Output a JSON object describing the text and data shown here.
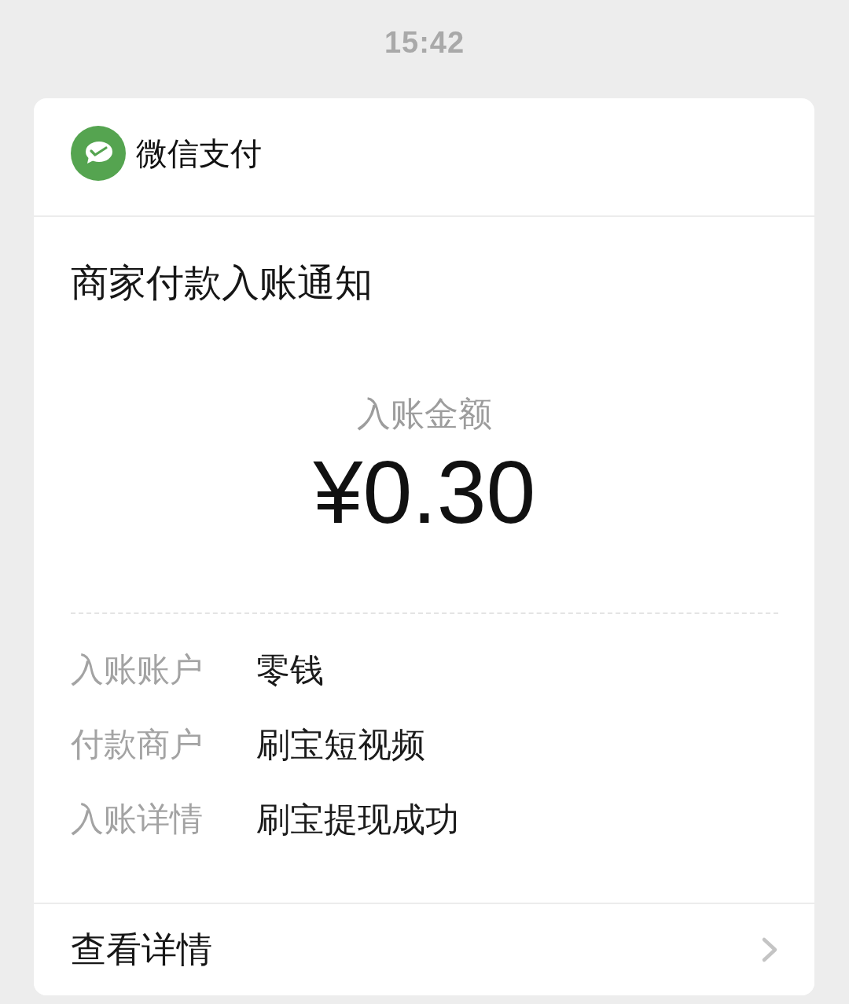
{
  "timestamp": "15:42",
  "card": {
    "brand": {
      "name": "微信支付"
    },
    "title": "商家付款入账通知",
    "amount": {
      "label": "入账金额",
      "value": "¥0.30"
    },
    "details": [
      {
        "label": "入账账户",
        "value": "零钱"
      },
      {
        "label": "付款商户",
        "value": "刷宝短视频"
      },
      {
        "label": "入账详情",
        "value": "刷宝提现成功"
      }
    ],
    "footer": {
      "link": "查看详情"
    }
  }
}
